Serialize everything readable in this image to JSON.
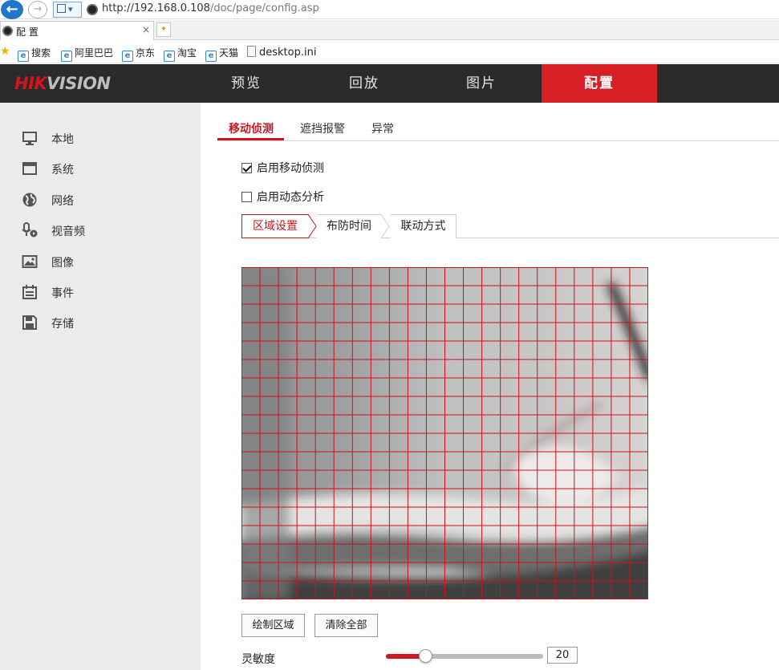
{
  "browser": {
    "back_glyph": "←",
    "forward_glyph": "→",
    "compat_glyph": "▾",
    "url_host": "http://192.168.0.108",
    "url_path": "/doc/page/config.asp",
    "tab_title": "配 置",
    "tab_close": "×",
    "new_tab_glyph": "✦",
    "favorites": [
      {
        "label": "搜索",
        "icon": "ie-icon"
      },
      {
        "label": "阿里巴巴",
        "icon": "ie-icon"
      },
      {
        "label": "京东",
        "icon": "ie-icon"
      },
      {
        "label": "淘宝",
        "icon": "ie-icon"
      },
      {
        "label": "天猫",
        "icon": "ie-icon"
      },
      {
        "label": "desktop.ini",
        "icon": "document-icon"
      }
    ]
  },
  "header": {
    "logo_hik": "HIK",
    "logo_vision": "VISION",
    "nav": [
      {
        "label": "预览",
        "active": false
      },
      {
        "label": "回放",
        "active": false
      },
      {
        "label": "图片",
        "active": false
      },
      {
        "label": "配置",
        "active": true
      }
    ],
    "accent_color": "#d81f26"
  },
  "sidebar": {
    "items": [
      {
        "label": "本地",
        "icon": "monitor-icon"
      },
      {
        "label": "系统",
        "icon": "window-icon"
      },
      {
        "label": "网络",
        "icon": "globe-icon"
      },
      {
        "label": "视音频",
        "icon": "microphone-icon"
      },
      {
        "label": "图像",
        "icon": "image-icon"
      },
      {
        "label": "事件",
        "icon": "calendar-icon"
      },
      {
        "label": "存储",
        "icon": "floppy-icon"
      }
    ]
  },
  "main": {
    "tabs": [
      {
        "label": "移动侦测",
        "active": true
      },
      {
        "label": "遮挡报警",
        "active": false
      },
      {
        "label": "异常",
        "active": false
      }
    ],
    "enable_motion": {
      "label": "启用移动侦测",
      "checked": true
    },
    "enable_dynamic": {
      "label": "启用动态分析",
      "checked": false
    },
    "sub_tabs": [
      {
        "label": "区域设置",
        "active": true
      },
      {
        "label": "布防时间",
        "active": false
      },
      {
        "label": "联动方式",
        "active": false
      }
    ],
    "grid": {
      "cols": 22,
      "rows": 18,
      "color": "#d0101a"
    },
    "draw_area_label": "绘制区域",
    "clear_all_label": "清除全部",
    "sensitivity": {
      "label": "灵敏度",
      "value": "20",
      "fraction": 0.2
    }
  }
}
